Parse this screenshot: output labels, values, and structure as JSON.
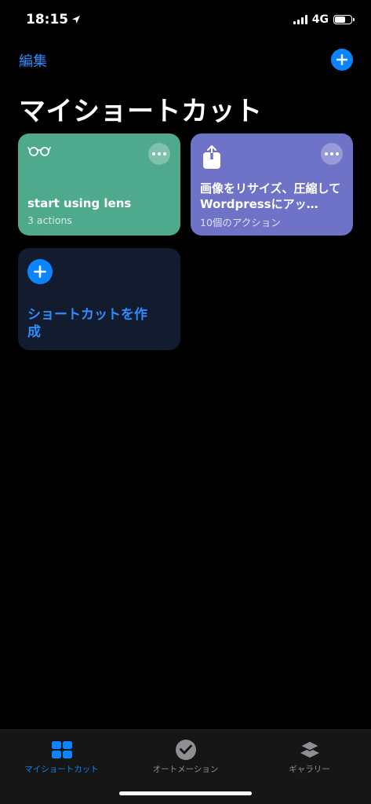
{
  "status_bar": {
    "time": "18:15",
    "network": "4G",
    "battery_level": 0.7
  },
  "header": {
    "edit_label": "編集",
    "title": "マイショートカット"
  },
  "cards": [
    {
      "title": "start using lens",
      "subtitle": "3 actions",
      "color": "#4ea98d",
      "icon": "glasses-icon"
    },
    {
      "title": "画像をリサイズ、圧縮してWordpressにアッ…",
      "subtitle": "10個のアクション",
      "color": "#6f73c8",
      "icon": "share-icon"
    }
  ],
  "create_card": {
    "label": "ショートカットを作成",
    "color": "#121c2e",
    "icon": "plus-icon"
  },
  "tab_bar": {
    "tabs": [
      {
        "label": "マイショートカット",
        "icon": "grid-icon",
        "active": true
      },
      {
        "label": "オートメーション",
        "icon": "clock-check-icon",
        "active": false
      },
      {
        "label": "ギャラリー",
        "icon": "layers-icon",
        "active": false
      }
    ]
  },
  "colors": {
    "accent": "#0a84ff",
    "background": "#000000",
    "tab_bar": "#161616"
  }
}
